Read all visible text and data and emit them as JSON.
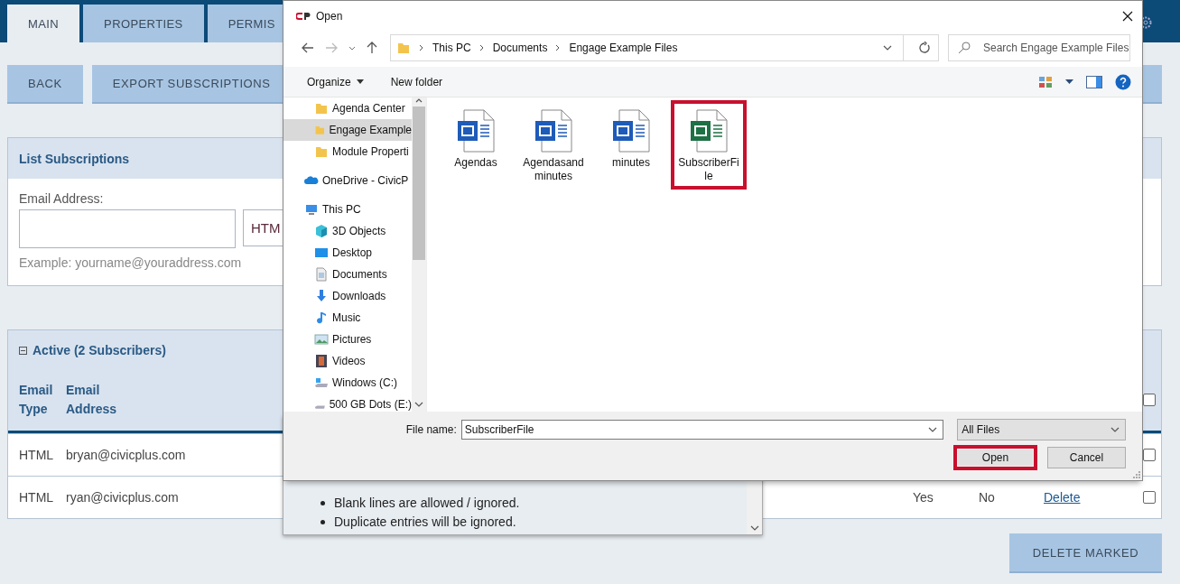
{
  "page": {
    "tabs": [
      {
        "label": "MAIN",
        "selected": true
      },
      {
        "label": "PROPERTIES",
        "selected": false
      },
      {
        "label": "PERMIS",
        "selected": false
      }
    ],
    "buttons": [
      "BACK",
      "EXPORT SUBSCRIPTIONS"
    ],
    "list_subscriptions": {
      "title": "List Subscriptions",
      "email_label": "Email Address:",
      "email_type_value": "HTM",
      "example": "Example: yourname@youraddress.com"
    },
    "active": {
      "title": "Active (2 Subscribers)",
      "expanded": true,
      "columns": [
        "Email Type",
        "Email Address"
      ],
      "header_checked": false,
      "rows": [
        {
          "email_type": "HTML",
          "email_address": "bryan@civicplus.com",
          "checked": false
        },
        {
          "email_type": "HTML",
          "email_address": "ryan@civicplus.com",
          "column_3": "Yes",
          "column_4": "No",
          "action": "Delete",
          "checked": false
        }
      ]
    },
    "delete_button": "DELETE MARKED"
  },
  "popup": {
    "notes": [
      "Blank lines are allowed / ignored.",
      "Duplicate entries will be ignored."
    ]
  },
  "dialog": {
    "title": "Open",
    "breadcrumb": [
      "This PC",
      "Documents",
      "Engage Example Files"
    ],
    "search_placeholder": "Search Engage Example Files",
    "toolbar": [
      {
        "label": "Organize",
        "menu": true
      },
      {
        "label": "New folder",
        "menu": false
      }
    ],
    "nav": [
      {
        "children": [
          {
            "label": "Agenda Center",
            "kind": "folder",
            "selected": false
          },
          {
            "label": "Engage Example",
            "kind": "folder",
            "selected": true
          },
          {
            "label": "Module Properti",
            "kind": "folder",
            "selected": false
          }
        ]
      },
      {
        "label": "OneDrive - CivicP",
        "kind": "cloud",
        "selected": false
      },
      {
        "label": "This PC",
        "kind": "pc",
        "selected": false,
        "children": [
          {
            "label": "3D Objects",
            "kind": "cube",
            "selected": false
          },
          {
            "label": "Desktop",
            "kind": "desktop",
            "selected": false
          },
          {
            "label": "Documents",
            "kind": "documents",
            "selected": false
          },
          {
            "label": "Downloads",
            "kind": "downloads",
            "selected": false
          },
          {
            "label": "Music",
            "kind": "music",
            "selected": false
          },
          {
            "label": "Pictures",
            "kind": "pictures",
            "selected": false
          },
          {
            "label": "Videos",
            "kind": "videos",
            "selected": false
          },
          {
            "label": "Windows (C:)",
            "kind": "system_drive",
            "selected": false
          },
          {
            "label": "500 GB Dots (E:)",
            "kind": "drive",
            "selected": false
          }
        ]
      }
    ],
    "files": [
      {
        "name": "Agendas",
        "kind": "word",
        "highlighted": false
      },
      {
        "name": "Agendasandminutes",
        "kind": "word",
        "highlighted": false
      },
      {
        "name": "minutes",
        "kind": "word",
        "highlighted": false
      },
      {
        "name": "SubscriberFile",
        "kind": "excel",
        "highlighted": true
      }
    ],
    "file_name_label": "File name:",
    "file_name": "SubscriberFile",
    "file_type": "All Files",
    "buttons": [
      {
        "label": "Open",
        "highlighted": true
      },
      {
        "label": "Cancel",
        "highlighted": false
      }
    ]
  }
}
